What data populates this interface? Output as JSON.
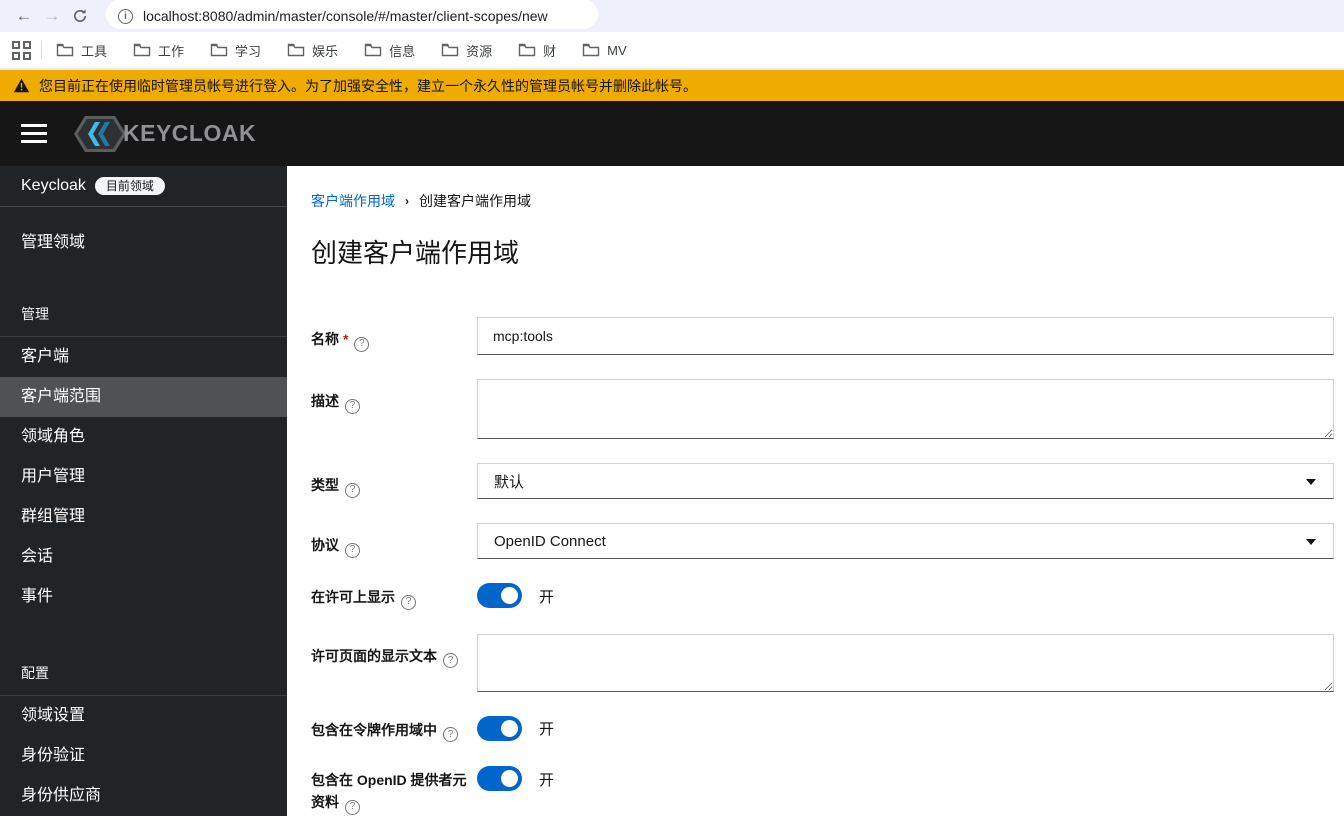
{
  "browser": {
    "url": "localhost:8080/admin/master/console/#/master/client-scopes/new",
    "info_icon_glyph": "i",
    "bookmarks": [
      "工具",
      "工作",
      "学习",
      "娱乐",
      "信息",
      "资源",
      "财",
      "MV"
    ]
  },
  "banner": {
    "text": "您目前正在使用临时管理员帐号进行登入。为了加强安全性，建立一个永久性的管理员帐号并删除此帐号。"
  },
  "header": {
    "logo_text": "KEYCLOAK"
  },
  "sidebar": {
    "realm_name": "Keycloak",
    "realm_badge": "目前领域",
    "manage_realms": "管理领域",
    "manage_title": "管理",
    "manage_items": [
      "客户端",
      "客户端范围",
      "领域角色",
      "用户管理",
      "群组管理",
      "会话",
      "事件"
    ],
    "selected_item": "客户端范围",
    "configure_title": "配置",
    "configure_items": [
      "领域设置",
      "身份验证",
      "身份供应商"
    ]
  },
  "breadcrumb": {
    "parent": "客户端作用域",
    "current": "创建客户端作用域"
  },
  "page": {
    "title": "创建客户端作用域"
  },
  "form": {
    "name_label": "名称",
    "name_value": "mcp:tools",
    "description_label": "描述",
    "description_value": "",
    "type_label": "类型",
    "type_value": "默认",
    "protocol_label": "协议",
    "protocol_value": "OpenID Connect",
    "display_on_consent_label": "在许可上显示",
    "consent_text_label": "许可页面的显示文本",
    "consent_text_value": "",
    "include_token_scope_label": "包含在令牌作用域中",
    "include_oidc_metadata_label": "包含在 OpenID 提供者元资料",
    "toggle_on_label": "开",
    "help_glyph": "?"
  },
  "colors": {
    "accent_blue": "#0066cc",
    "warning_gold": "#f0ab00",
    "header_bg": "#161616",
    "sidebar_bg": "#212427",
    "sidebar_selected": "#4f5255",
    "required_red": "#c9190b"
  }
}
